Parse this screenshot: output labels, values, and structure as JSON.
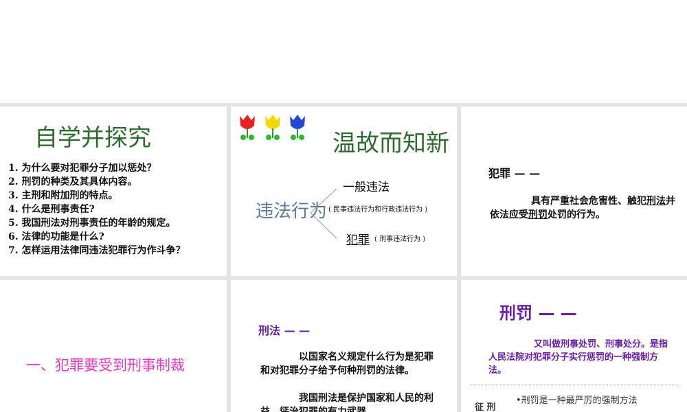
{
  "slide1": {
    "title": "自学并探究",
    "questions": [
      "1. 为什么要对犯罪分子加以惩处？",
      "2. 刑罚的种类及其具体内容。",
      "3. 主刑和附加刑的特点。",
      "4. 什么是刑事责任?",
      "5. 我国刑法对刑事责任的年龄的规定。",
      "6. 法律的功能是什么?",
      "7. 怎样运用法律同违法犯罪行为作斗争？"
    ]
  },
  "slide2": {
    "title": "温故而知新",
    "root": "违法行为",
    "branch1": "一般违法",
    "branch1_note": "( 民事违法行为和行政违法行为 )",
    "branch2": "犯罪",
    "branch2_note": "( 刑事违法行为 )",
    "tulip_colors": [
      "#e52222",
      "#f0d800",
      "#2346d8"
    ]
  },
  "slide3": {
    "heading": "犯罪 — —",
    "def_part1": "具有严重社会危害性、触犯",
    "def_u1": "刑法",
    "def_part2": "并依法应受",
    "def_u2": "刑罚",
    "def_part3": "处罚的行为。"
  },
  "slide4": {
    "title": "一、犯罪要受到刑事制裁"
  },
  "slide5": {
    "heading": "刑法 — —",
    "para1": "以国家名义规定什么行为是犯罪和对犯罪分子给予何种刑罚的法律。",
    "para2": "我国刑法是保护国家和人民的利益、惩治犯罪的有力武器。"
  },
  "slide6": {
    "heading": "刑罚 — —",
    "def": "又叫做刑事处罚、刑事处分。是指人民法院对犯罪分子实行惩罚的一种强制方法。",
    "side_label": "征 刑",
    "bullet": "•刑罚是一种最严厉的强制方法"
  }
}
